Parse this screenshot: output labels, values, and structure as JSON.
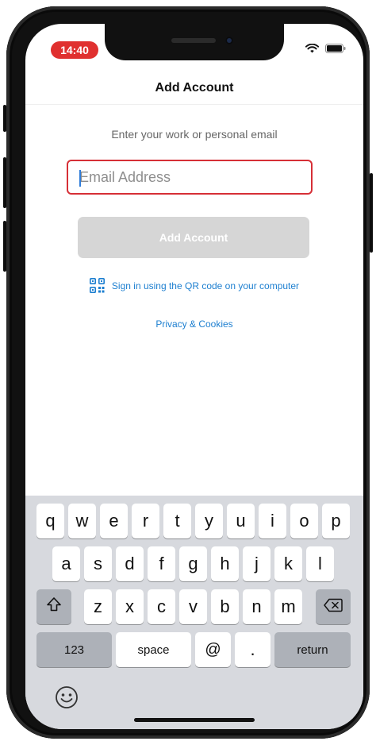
{
  "status_bar": {
    "time": "14:40"
  },
  "nav": {
    "title": "Add Account"
  },
  "form": {
    "instructions": "Enter your work or personal email",
    "email_placeholder": "Email Address",
    "email_value": "",
    "add_account_label": "Add Account"
  },
  "links": {
    "qr_signin": "Sign in using the QR code on your computer",
    "privacy": "Privacy & Cookies"
  },
  "keyboard": {
    "row1": [
      "q",
      "w",
      "e",
      "r",
      "t",
      "y",
      "u",
      "i",
      "o",
      "p"
    ],
    "row2": [
      "a",
      "s",
      "d",
      "f",
      "g",
      "h",
      "j",
      "k",
      "l"
    ],
    "row3": [
      "z",
      "x",
      "c",
      "v",
      "b",
      "n",
      "m"
    ],
    "numbers_key": "123",
    "space_key": "space",
    "at_key": "@",
    "dot_key": ".",
    "return_key": "return"
  },
  "icons": [
    "wifi-icon",
    "battery-icon",
    "qr-code-icon",
    "shift-icon",
    "delete-icon",
    "emoji-icon"
  ],
  "colors": {
    "time_pill": "#e0302f",
    "highlight_border": "#d62f36",
    "link_blue": "#1d7fd0",
    "button_disabled": "#d6d6d6",
    "keyboard_bg": "#d7d9de"
  }
}
